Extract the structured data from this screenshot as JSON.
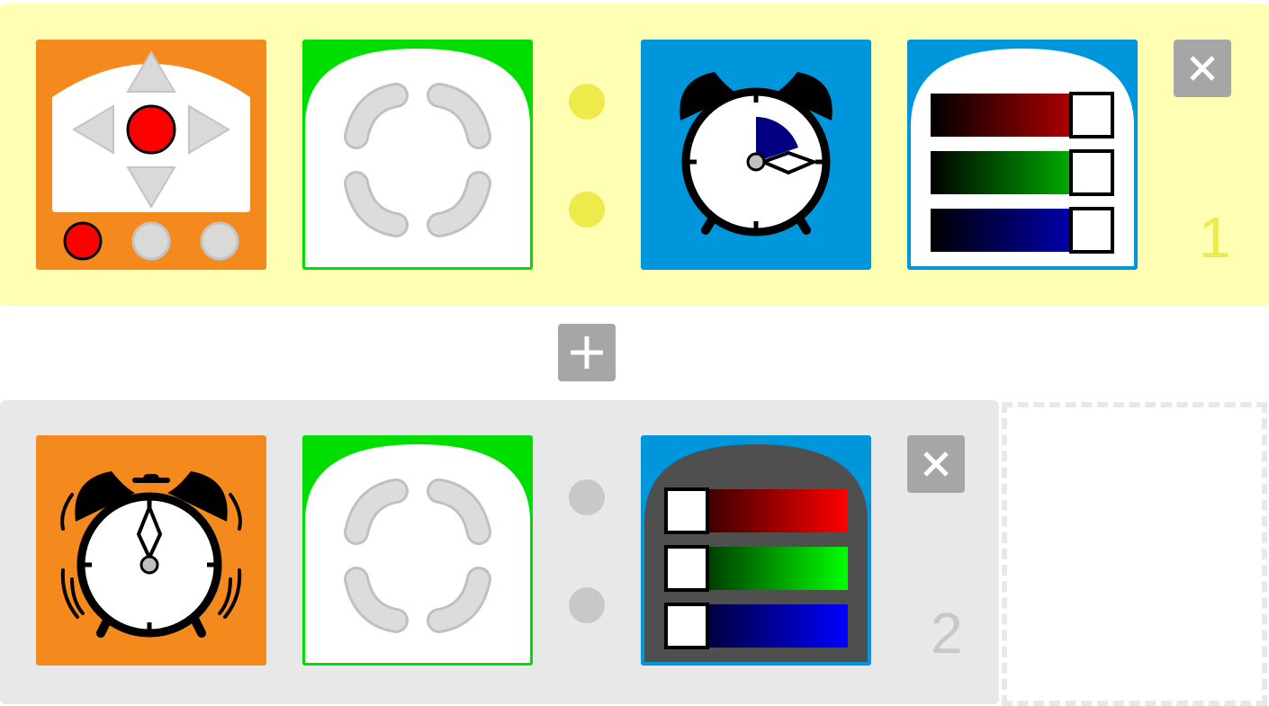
{
  "colors": {
    "row1_background": "#ffffb4",
    "row2_background": "#e8e8e8",
    "trigger_orange": "#f48a1e",
    "condition_green": "#00dd00",
    "action_blue": "#0096dc",
    "row1_dot": "#eeea4c",
    "row2_dot": "#c8c8c8",
    "control_button": "#a6a6a6"
  },
  "row1": {
    "number": "1",
    "trigger_icon": "gamepad-icon",
    "condition_icon": "any-direction-icon",
    "action_icon": "alarm-clock-timer-icon",
    "action2_icon": "rgb-sliders-icon",
    "delete_icon": "close-icon"
  },
  "add_row_icon": "plus-icon",
  "row2": {
    "number": "2",
    "trigger_icon": "ringing-alarm-clock-icon",
    "condition_icon": "any-direction-icon",
    "action_icon": "rgb-sliders-icon",
    "delete_icon": "close-icon"
  }
}
